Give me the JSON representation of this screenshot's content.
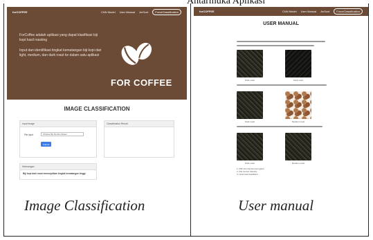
{
  "top_caption": "Antarmuka Aplikasi",
  "image_classification_screen": {
    "navbar": {
      "brand": "forCOFFEE",
      "links": [
        "CNN Model",
        "User Manual",
        "AnScot"
      ],
      "pill": "ForceClassification"
    },
    "hero": {
      "paragraph1": "ForCoffee adalah aplikasi yang dapat klasifikasi biji kopi hasil roasting",
      "paragraph2": "Input dan identifikasi tingkat kematangan biji kopi dari light, medium, dan dark roast ke dalam satu aplikasi",
      "title": "FOR COFFEE",
      "beans_icon": "coffee-beans-icon"
    },
    "section_title": "IMAGE CLASSIFICATION",
    "upload_card": {
      "header": "Input Image",
      "field_label": "File input",
      "file_button": "Choose file",
      "file_name": "No file chosen",
      "submit": "Submit"
    },
    "result_card": {
      "header": "Classification Result"
    },
    "info_card": {
      "header": "Keterangan",
      "text": "Biji kopi dark roast menunjukkan tingkat kematangan tinggi"
    }
  },
  "user_manual_screen": {
    "navbar": {
      "brand": "forCOFFEE",
      "links": [
        "CNN Model",
        "User Manual",
        "AnScot"
      ],
      "pill": "ForceClassification"
    },
    "title": "USER MANUAL",
    "steps": [
      "1. Pilih foto biji kopi dari galeri",
      "2. Klik tombol Classify",
      "3. Lihat hasil klasifikasi"
    ],
    "thumbnail_captions": [
      "Dark roast",
      "Dark roast",
      "Dark roast",
      "Medium roast",
      "Dark roast",
      "Medium roast"
    ]
  },
  "bottom_captions": {
    "left": "Image Classification",
    "right": "User manual"
  }
}
